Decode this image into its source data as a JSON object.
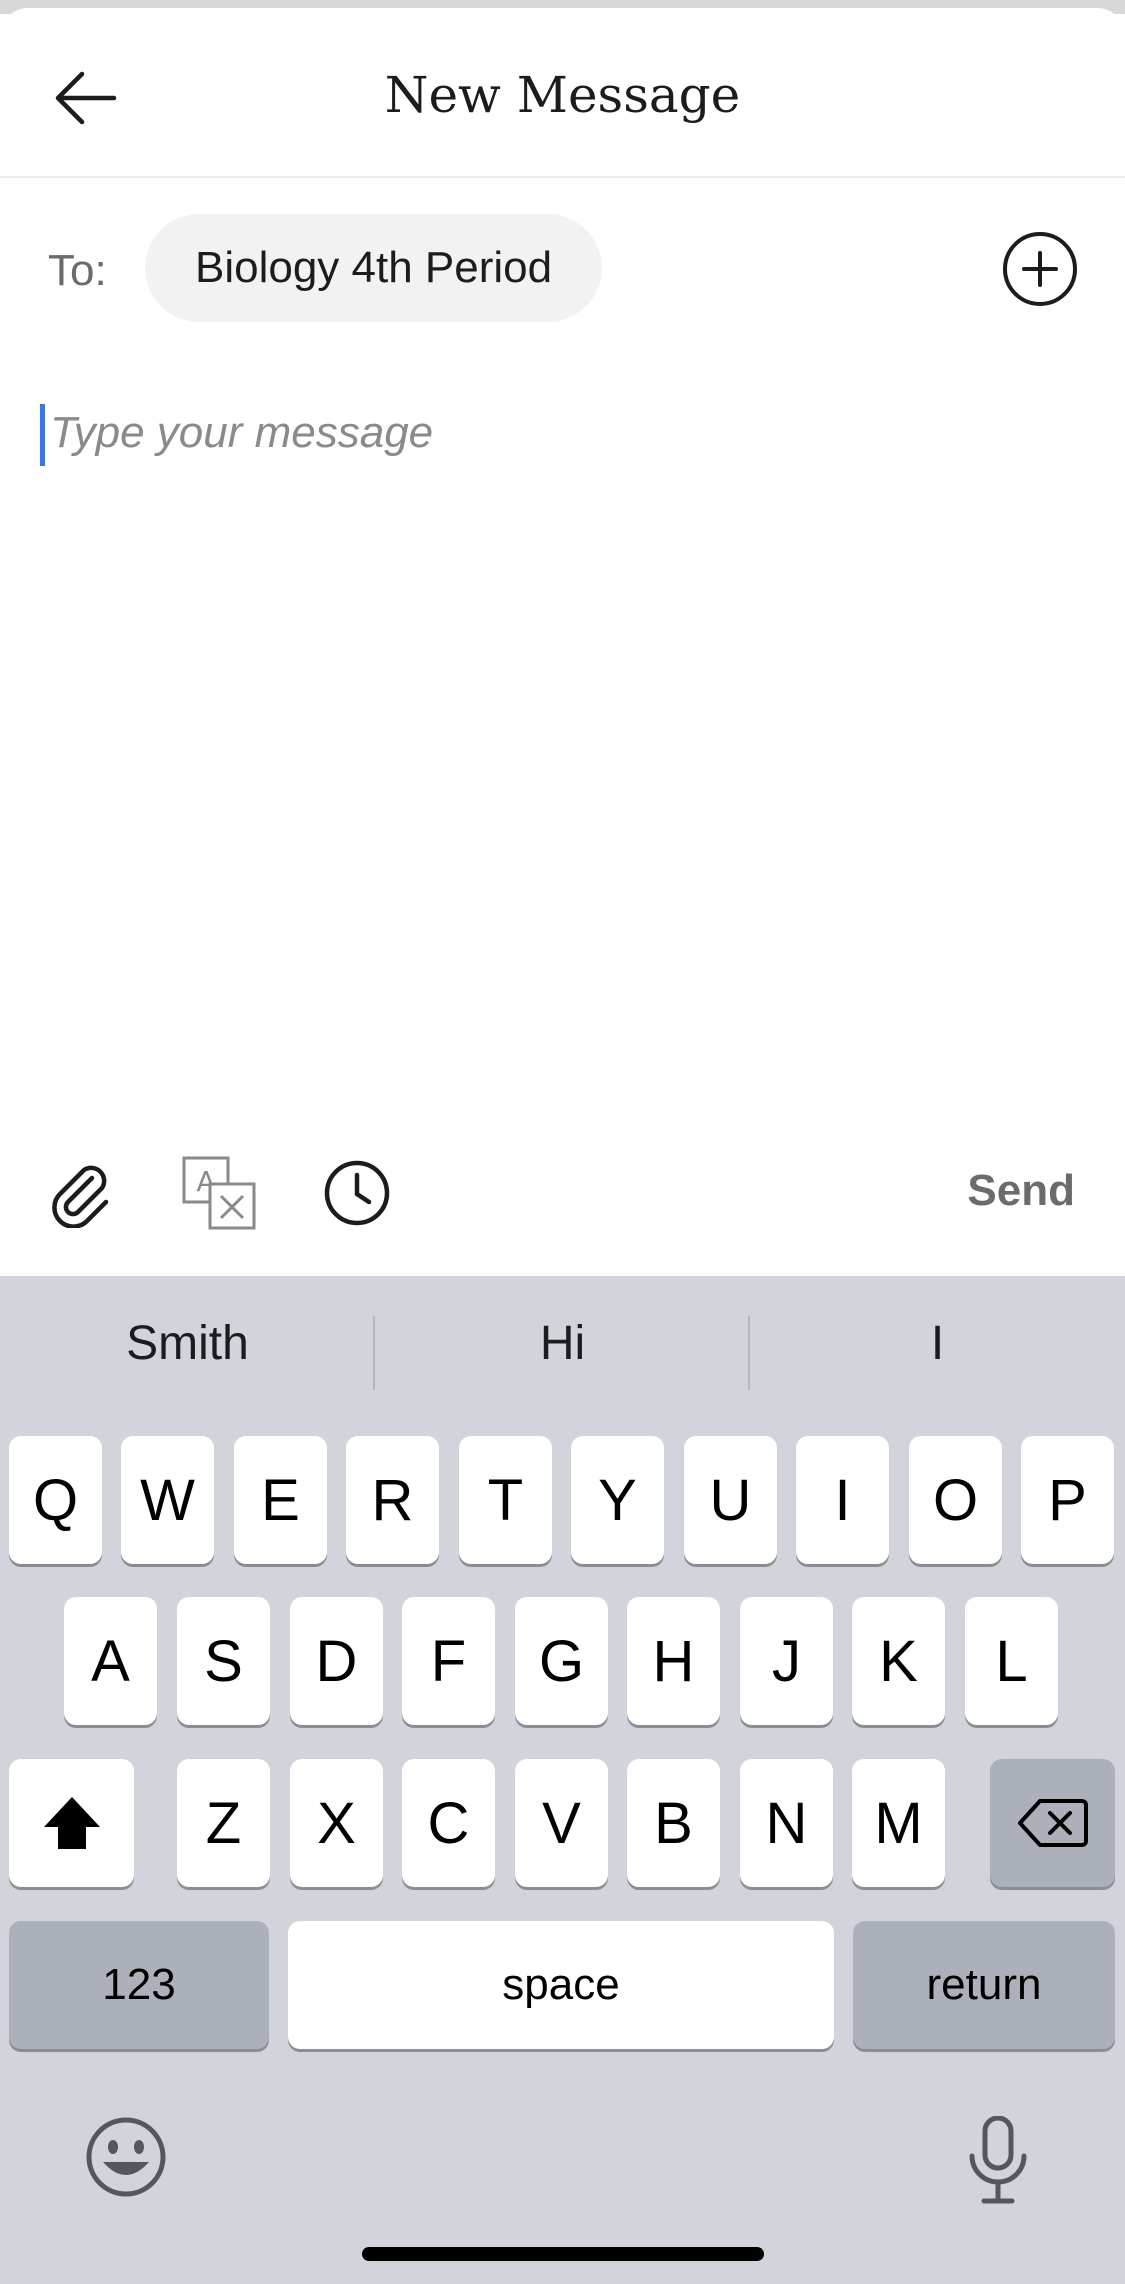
{
  "header": {
    "title": "New Message"
  },
  "recipient": {
    "to_label": "To:",
    "chip_label": "Biology 4th Period"
  },
  "composer": {
    "placeholder": "Type your message"
  },
  "toolbar": {
    "send_label": "Send"
  },
  "keyboard": {
    "suggestions": [
      "Smith",
      "Hi",
      "I"
    ],
    "row1": [
      "Q",
      "W",
      "E",
      "R",
      "T",
      "Y",
      "U",
      "I",
      "O",
      "P"
    ],
    "row2": [
      "A",
      "S",
      "D",
      "F",
      "G",
      "H",
      "J",
      "K",
      "L"
    ],
    "row3": [
      "Z",
      "X",
      "C",
      "V",
      "B",
      "N",
      "M"
    ],
    "numbers_label": "123",
    "space_label": "space",
    "return_label": "return"
  },
  "colors": {
    "caret": "#3478f6",
    "keyboard_bg": "#d1d4db",
    "key_bg": "#ffffff",
    "key_dark_bg": "#abb0ba"
  }
}
